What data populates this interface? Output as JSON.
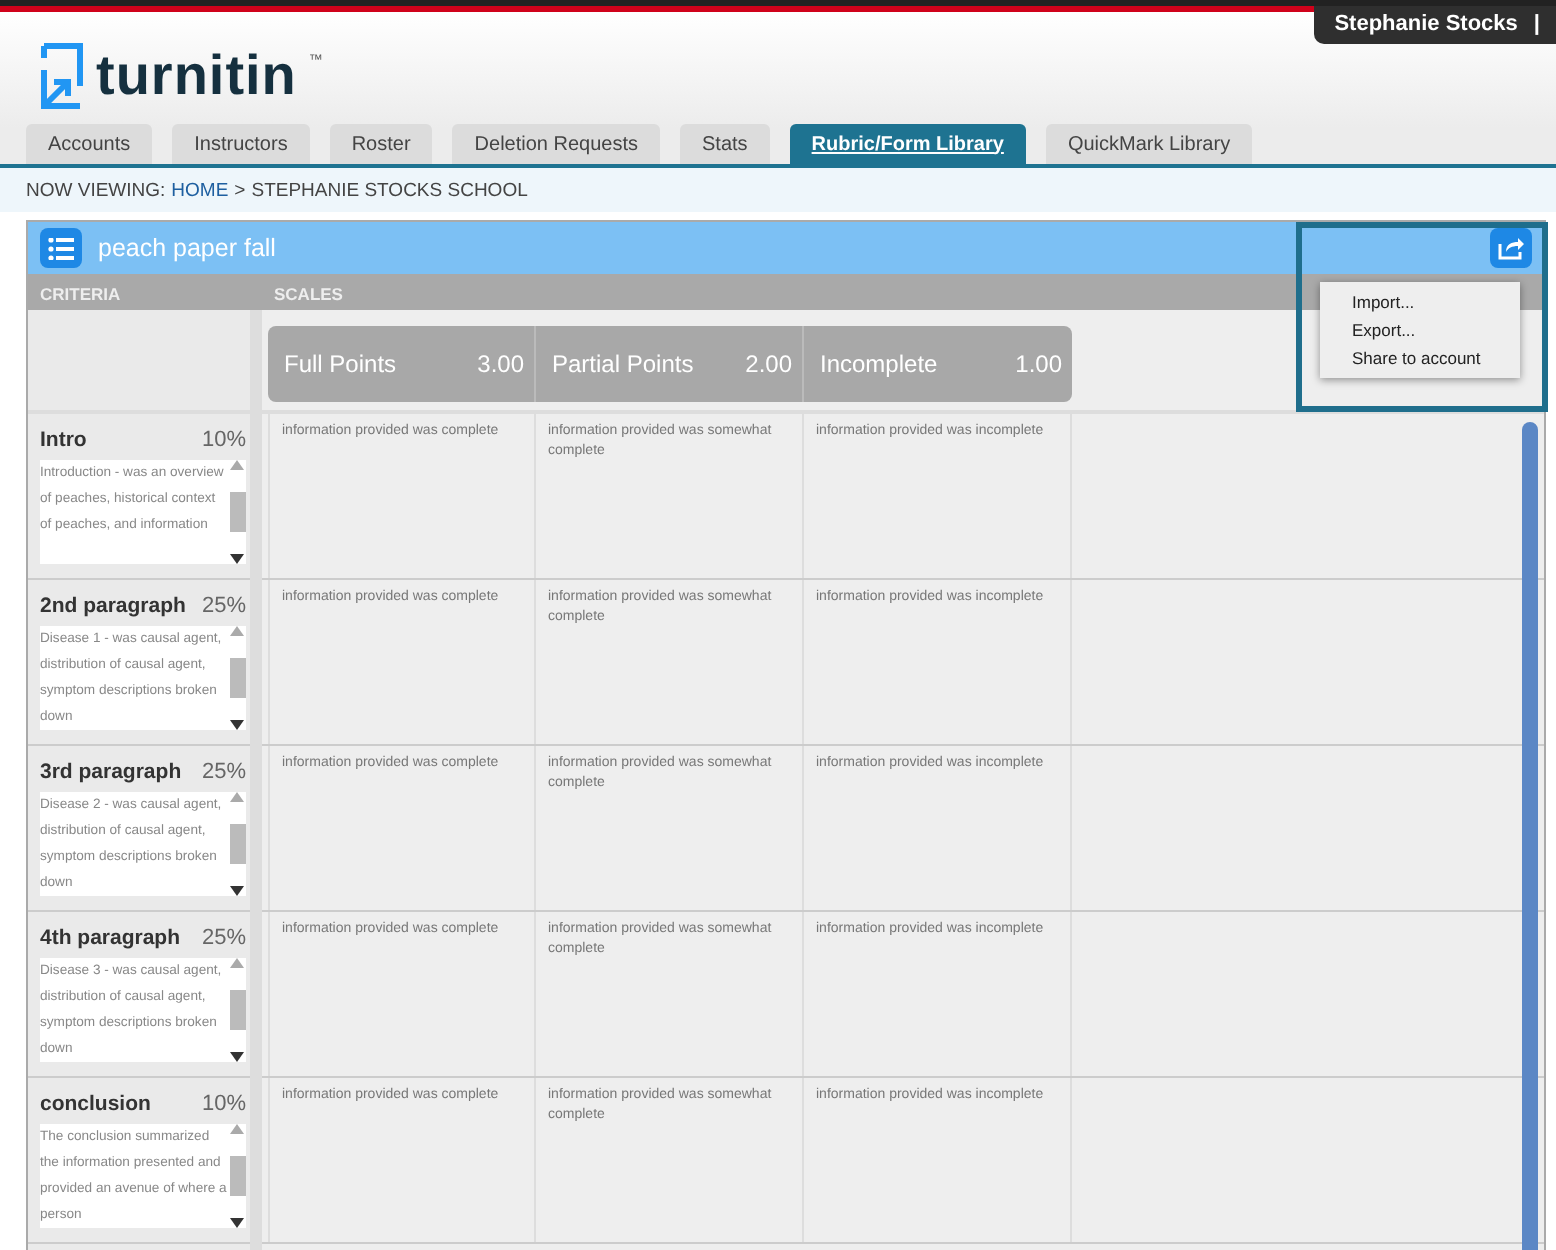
{
  "user": {
    "name": "Stephanie Stocks",
    "separator": "|"
  },
  "logo": {
    "text": "turnitin",
    "mark": "™"
  },
  "tabs": [
    {
      "label": "Accounts",
      "selected": false
    },
    {
      "label": "Instructors",
      "selected": false
    },
    {
      "label": "Roster",
      "selected": false
    },
    {
      "label": "Deletion Requests",
      "selected": false
    },
    {
      "label": "Stats",
      "selected": false
    },
    {
      "label": "Rubric/Form Library",
      "selected": true
    },
    {
      "label": "QuickMark Library",
      "selected": false
    }
  ],
  "breadcrumb": {
    "prefix": "NOW VIEWING:",
    "home": "HOME",
    "separator": ">",
    "current": "STEPHANIE STOCKS SCHOOL"
  },
  "rubric": {
    "title": "peach paper fall",
    "criteria_heading": "CRITERIA",
    "scales_heading": "SCALES",
    "scales": [
      {
        "name": "Full Points",
        "points": "3.00"
      },
      {
        "name": "Partial Points",
        "points": "2.00"
      },
      {
        "name": "Incomplete",
        "points": "1.00"
      }
    ],
    "criteria": [
      {
        "name": "Intro",
        "weight": "10%",
        "description": "Introduction - was an overview of peaches, historical context of peaches, and information",
        "cells": [
          "information provided was complete",
          "information provided was somewhat complete",
          "information provided was incomplete"
        ]
      },
      {
        "name": "2nd paragraph",
        "weight": "25%",
        "description": "Disease 1 - was causal agent, distribution of causal agent, symptom descriptions broken down",
        "cells": [
          "information provided was complete",
          "information provided was somewhat complete",
          "information provided was incomplete"
        ]
      },
      {
        "name": "3rd paragraph",
        "weight": "25%",
        "description": "Disease 2 - was causal agent, distribution of causal agent, symptom descriptions broken down",
        "cells": [
          "information provided was complete",
          "information provided was somewhat complete",
          "information provided was incomplete"
        ]
      },
      {
        "name": "4th paragraph",
        "weight": "25%",
        "description": "Disease 3 - was causal agent, distribution of causal agent, symptom descriptions broken down",
        "cells": [
          "information provided was complete",
          "information provided was somewhat complete",
          "information provided was incomplete"
        ]
      },
      {
        "name": "conclusion",
        "weight": "10%",
        "description": "The conclusion summarized the information presented and provided an avenue of where a person",
        "cells": [
          "information provided was complete",
          "information provided was somewhat complete",
          "information provided was incomplete"
        ]
      }
    ],
    "share_menu": {
      "expanded": true,
      "items": [
        "Import...",
        "Export...",
        "Share to account"
      ]
    }
  }
}
